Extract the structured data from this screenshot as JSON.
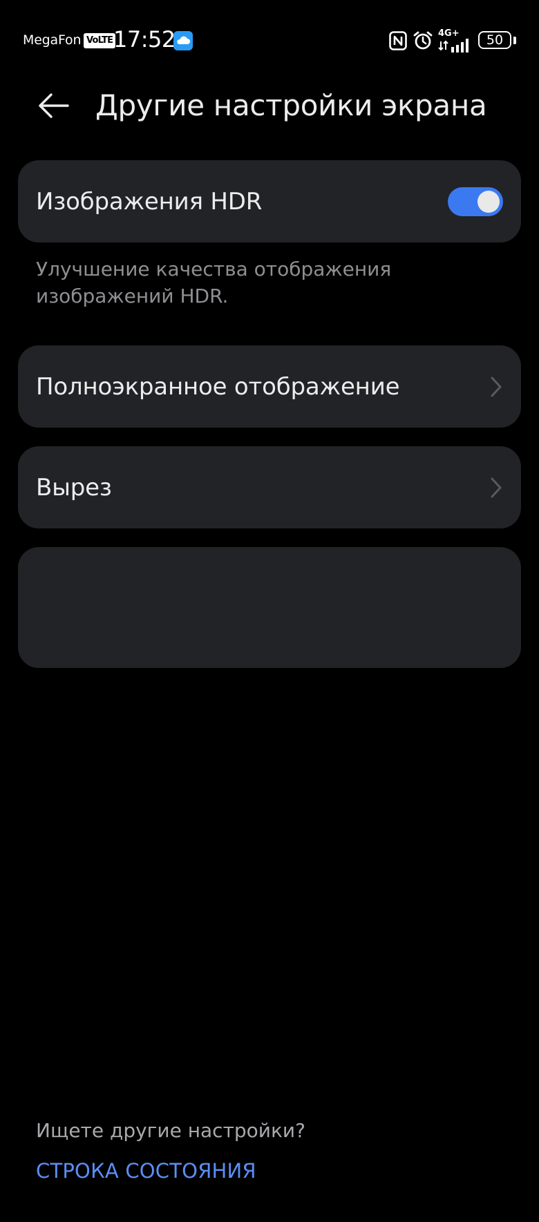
{
  "status_bar": {
    "carrier": "MegaFon",
    "volte_badge": "VoLTE",
    "time": "17:52",
    "network_badge_top": "4G+",
    "battery_level": "50",
    "icons": [
      "cloud-icon",
      "nfc-icon",
      "alarm-icon",
      "signal-icon",
      "battery-icon"
    ]
  },
  "header": {
    "back_icon": "arrow-left-icon",
    "title": "Другие настройки экрана"
  },
  "hdr_card": {
    "label": "Изображения HDR",
    "toggle_on": true,
    "description": "Улучшение качества отображения изображений HDR."
  },
  "items": [
    {
      "label": "Полноэкранное отображение",
      "icon": "chevron-right-icon"
    },
    {
      "label": "Вырез",
      "icon": "chevron-right-icon"
    }
  ],
  "search_card": {
    "prompt": "Ищете другие настройки?",
    "link": "СТРОКА СОСТОЯНИЯ"
  },
  "colors": {
    "background": "#000000",
    "card": "#222326",
    "accent": "#3b79f0",
    "link": "#5b8ef5",
    "text_primary": "#ececec",
    "text_secondary": "#8f8f93"
  }
}
